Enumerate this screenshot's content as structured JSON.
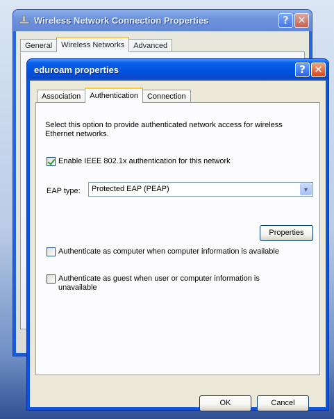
{
  "back_window": {
    "title": "Wireless Network Connection Properties",
    "tabs": [
      "General",
      "Wireless Networks",
      "Advanced"
    ],
    "active_tab": 1
  },
  "front_window": {
    "title": "eduroam properties",
    "tabs": [
      "Association",
      "Authentication",
      "Connection"
    ],
    "active_tab": 1,
    "description": "Select this option to provide authenticated network access for wireless Ethernet networks.",
    "enable_8021x": {
      "label": "Enable IEEE 802.1x authentication for this network",
      "checked": true
    },
    "eap_type": {
      "label": "EAP type:",
      "value": "Protected EAP (PEAP)"
    },
    "properties_button": "Properties",
    "auth_computer": {
      "label": "Authenticate as computer when computer information is available",
      "checked": false
    },
    "auth_guest": {
      "label": "Authenticate as guest when user or computer information is unavailable",
      "checked": false
    },
    "ok_button": "OK",
    "cancel_button": "Cancel"
  },
  "icons": {
    "help": "question-mark-icon",
    "close": "close-x-icon",
    "network": "network-adapter-icon",
    "dropdown": "chevron-down-icon"
  },
  "colors": {
    "titlebar_blue": "#0053e0",
    "dialog_bg": "#ece9d8",
    "close_red": "#d9451b",
    "active_tab_accent": "#ffc83c",
    "check_green": "#21a121"
  }
}
